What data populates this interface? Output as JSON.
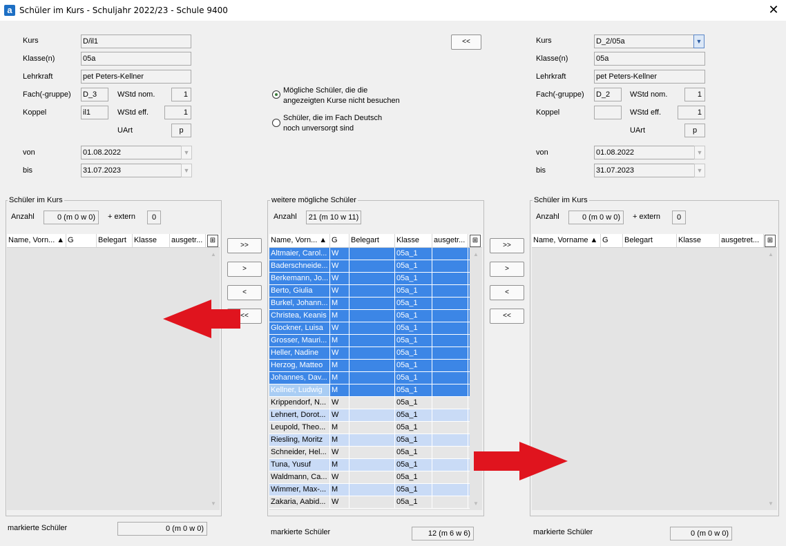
{
  "window": {
    "title": "Schüler im Kurs - Schuljahr 2022/23 - Schule 9400",
    "app_icon": "a",
    "close": "✕"
  },
  "left": {
    "kurs_label": "Kurs",
    "kurs": "D/il1",
    "klassen_label": "Klasse(n)",
    "klassen": "05a",
    "lehrkraft_label": "Lehrkraft",
    "lehrkraft": "pet Peters-Kellner",
    "fach_label": "Fach(-gruppe)",
    "fach": "D_3",
    "wstd_nom_label": "WStd nom.",
    "wstd_nom": "1",
    "koppel_label": "Koppel",
    "koppel": "il1",
    "wstd_eff_label": "WStd eff.",
    "wstd_eff": "1",
    "uart_label": "UArt",
    "uart": "p",
    "von_label": "von",
    "von": "01.08.2022",
    "bis_label": "bis",
    "bis": "31.07.2023"
  },
  "right": {
    "kurs_label": "Kurs",
    "kurs": "D_2/05a",
    "klassen_label": "Klasse(n)",
    "klassen": "05a",
    "lehrkraft_label": "Lehrkraft",
    "lehrkraft": "pet Peters-Kellner",
    "fach_label": "Fach(-gruppe)",
    "fach": "D_2",
    "wstd_nom_label": "WStd nom.",
    "wstd_nom": "1",
    "koppel_label": "Koppel",
    "koppel": "",
    "wstd_eff_label": "WStd eff.",
    "wstd_eff": "1",
    "uart_label": "UArt",
    "uart": "p",
    "von_label": "von",
    "von": "01.08.2022",
    "bis_label": "bis",
    "bis": "31.07.2023"
  },
  "top_swap_button": "<<",
  "options": {
    "opt1_line1": "Mögliche Schüler, die die",
    "opt1_line2": "angezeigten Kurse nicht besuchen",
    "opt2_line1": "Schüler, die im Fach Deutsch",
    "opt2_line2": "noch unversorgt sind",
    "selected": 1
  },
  "left_list": {
    "title": "Schüler im Kurs",
    "anzahl_label": "Anzahl",
    "anzahl": "0 (m 0 w 0)",
    "extern_label": "+ extern",
    "extern": "0",
    "columns": [
      "Name, Vorn... ▲",
      "G",
      "Belegart",
      "Klasse",
      "ausgetr..."
    ],
    "marked_label": "markierte Schüler",
    "marked": "0 (m 0 w 0)"
  },
  "middle_list": {
    "title": "weitere mögliche Schüler",
    "anzahl_label": "Anzahl",
    "anzahl": "21 (m 10 w 11)",
    "columns": [
      "Name, Vorn... ▲",
      "G",
      "Belegart",
      "Klasse",
      "ausgetr..."
    ],
    "rows": [
      {
        "name": "Altmaier, Carol...",
        "g": "W",
        "belegart": "",
        "klasse": "05a_1",
        "ausgetreten": ""
      },
      {
        "name": "Baderschneide...",
        "g": "W",
        "belegart": "",
        "klasse": "05a_1",
        "ausgetreten": ""
      },
      {
        "name": "Berkemann, Jo...",
        "g": "W",
        "belegart": "",
        "klasse": "05a_1",
        "ausgetreten": ""
      },
      {
        "name": "Berto, Giulia",
        "g": "W",
        "belegart": "",
        "klasse": "05a_1",
        "ausgetreten": ""
      },
      {
        "name": "Burkel, Johann...",
        "g": "M",
        "belegart": "",
        "klasse": "05a_1",
        "ausgetreten": ""
      },
      {
        "name": "Christea, Keanis",
        "g": "M",
        "belegart": "",
        "klasse": "05a_1",
        "ausgetreten": ""
      },
      {
        "name": "Glockner, Luisa",
        "g": "W",
        "belegart": "",
        "klasse": "05a_1",
        "ausgetreten": ""
      },
      {
        "name": "Grosser, Mauri...",
        "g": "M",
        "belegart": "",
        "klasse": "05a_1",
        "ausgetreten": ""
      },
      {
        "name": "Heller, Nadine",
        "g": "W",
        "belegart": "",
        "klasse": "05a_1",
        "ausgetreten": ""
      },
      {
        "name": "Herzog, Matteo",
        "g": "M",
        "belegart": "",
        "klasse": "05a_1",
        "ausgetreten": ""
      },
      {
        "name": "Johannes, Dav...",
        "g": "M",
        "belegart": "",
        "klasse": "05a_1",
        "ausgetreten": ""
      },
      {
        "name": "Kellner, Ludwig",
        "g": "M",
        "belegart": "",
        "klasse": "05a_1",
        "ausgetreten": ""
      },
      {
        "name": "Krippendorf, N...",
        "g": "W",
        "belegart": "",
        "klasse": "05a_1",
        "ausgetreten": ""
      },
      {
        "name": "Lehnert, Dorot...",
        "g": "W",
        "belegart": "",
        "klasse": "05a_1",
        "ausgetreten": ""
      },
      {
        "name": "Leupold, Theo...",
        "g": "M",
        "belegart": "",
        "klasse": "05a_1",
        "ausgetreten": ""
      },
      {
        "name": "Riesling, Moritz",
        "g": "M",
        "belegart": "",
        "klasse": "05a_1",
        "ausgetreten": ""
      },
      {
        "name": "Schneider, Hel...",
        "g": "W",
        "belegart": "",
        "klasse": "05a_1",
        "ausgetreten": ""
      },
      {
        "name": "Tuna, Yusuf",
        "g": "M",
        "belegart": "",
        "klasse": "05a_1",
        "ausgetreten": ""
      },
      {
        "name": "Waldmann, Ca...",
        "g": "W",
        "belegart": "",
        "klasse": "05a_1",
        "ausgetreten": ""
      },
      {
        "name": "Wimmer, Max-...",
        "g": "M",
        "belegart": "",
        "klasse": "05a_1",
        "ausgetreten": ""
      },
      {
        "name": "Zakaria, Aabid...",
        "g": "W",
        "belegart": "",
        "klasse": "05a_1",
        "ausgetreten": ""
      }
    ],
    "selected_count": 12,
    "marked_label": "markierte Schüler",
    "marked": "12 (m 6 w 6)"
  },
  "right_list": {
    "title": "Schüler im Kurs",
    "anzahl_label": "Anzahl",
    "anzahl": "0 (m 0 w 0)",
    "extern_label": "+ extern",
    "extern": "0",
    "columns": [
      "Name, Vorname ▲",
      "G",
      "Belegart",
      "Klasse",
      "ausgetret..."
    ],
    "marked_label": "markierte Schüler",
    "marked": "0 (m 0 w 0)"
  },
  "move_buttons": {
    "all_right": ">>",
    "one_right": ">",
    "one_left": "<",
    "all_left": "<<"
  },
  "colors": {
    "selection": "#3c86e6",
    "arrow": "#e0141e",
    "alt_row": "#c9dbf6"
  }
}
